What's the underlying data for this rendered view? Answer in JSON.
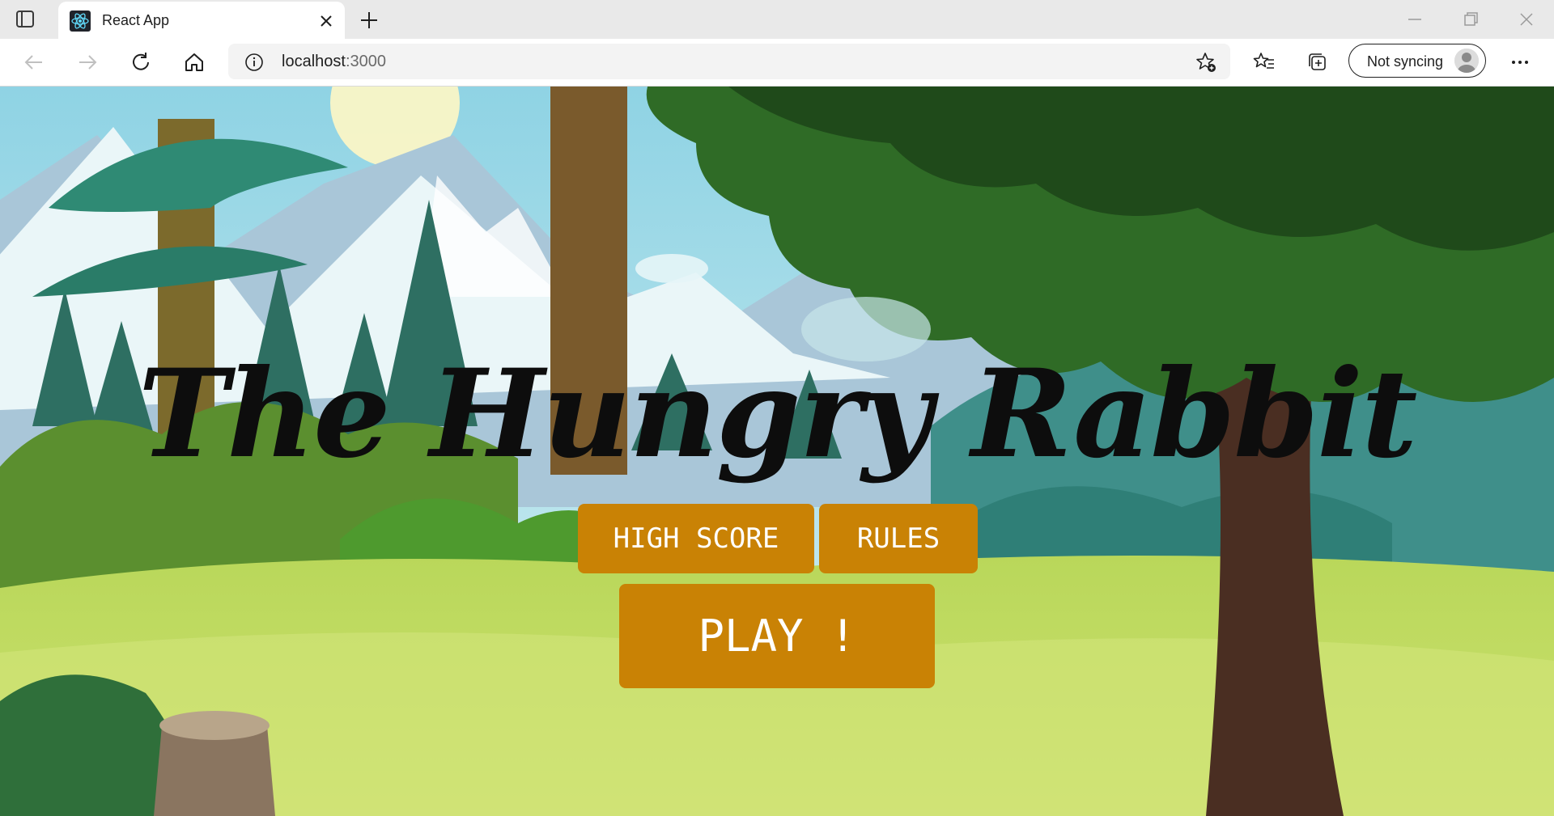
{
  "browser": {
    "tab_title": "React App",
    "url_host": "localhost",
    "url_port": ":3000",
    "sync_label": "Not syncing",
    "icons": [
      "tab-actions-icon",
      "react-logo-icon",
      "close-icon",
      "plus-icon",
      "minimize-icon",
      "restore-icon",
      "window-close-icon",
      "back-arrow-icon",
      "forward-arrow-icon",
      "refresh-icon",
      "home-icon",
      "info-icon",
      "favorite-add-icon",
      "favorites-list-icon",
      "collections-icon",
      "profile-avatar-icon",
      "more-dots-icon"
    ]
  },
  "game": {
    "title": "The Hungry Rabbit",
    "buttons": {
      "high_score": "HIGH SCORE",
      "rules": "RULES",
      "play": "PLAY !"
    },
    "colors": {
      "button": "#c98205",
      "button_text": "#ffffff",
      "title": "#0d0d0d"
    }
  }
}
